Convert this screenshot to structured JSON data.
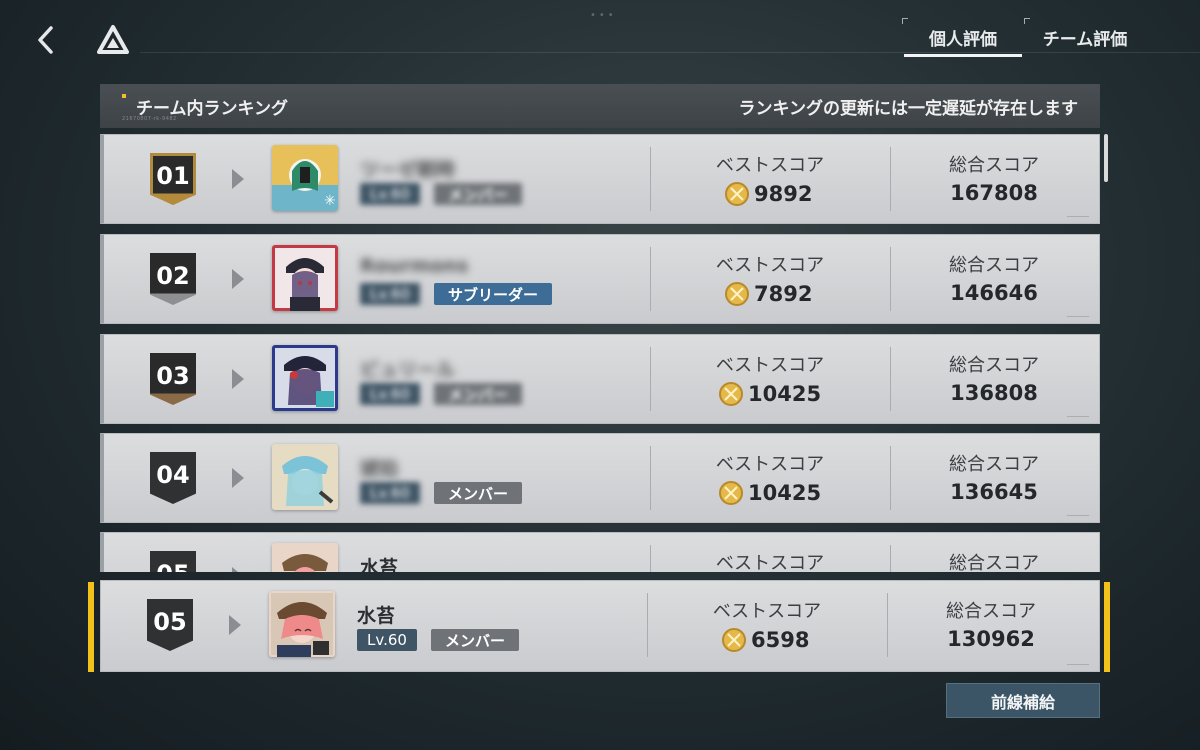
{
  "tabs": [
    {
      "label": "個人評価",
      "active": true
    },
    {
      "label": "チーム評価",
      "active": false
    }
  ],
  "header": {
    "title": "チーム内ランキング",
    "code": "21670807-rk-9482",
    "notice": "ランキングの更新には一定遅延が存在します"
  },
  "columns": {
    "best": "ベストスコア",
    "total": "総合スコア"
  },
  "rows": [
    {
      "rank": "01",
      "name": "ツーゼ朝時",
      "level": "Lv.60",
      "role": "メンバー",
      "best": "9892",
      "total": "167808"
    },
    {
      "rank": "02",
      "name": "Rourmons",
      "level": "Lv.60",
      "role": "サブリーダー",
      "best": "7892",
      "total": "146646"
    },
    {
      "rank": "03",
      "name": "ビュリール",
      "level": "Lv.60",
      "role": "メンバー",
      "best": "10425",
      "total": "136808"
    },
    {
      "rank": "04",
      "name": "琥珀",
      "level": "Lv.60",
      "role": "メンバー",
      "best": "10425",
      "total": "136645"
    },
    {
      "rank": "05",
      "name": "水苔",
      "level": "Lv.60",
      "role": "メンバー",
      "best": "6598",
      "total": "130962"
    }
  ],
  "self": {
    "rank": "05",
    "name": "水苔",
    "level": "Lv.60",
    "role": "メンバー",
    "best": "6598",
    "total": "130962"
  },
  "supply_button": "前線補給",
  "colors": {
    "accent": "#f2c21a",
    "button": "#3c5566",
    "leader": "#3d6c97",
    "level": "#3f5565"
  },
  "icons": {
    "back": "chevron-left-icon",
    "logo": "triangle-logo-icon",
    "medal": "gold-medal-icon"
  }
}
